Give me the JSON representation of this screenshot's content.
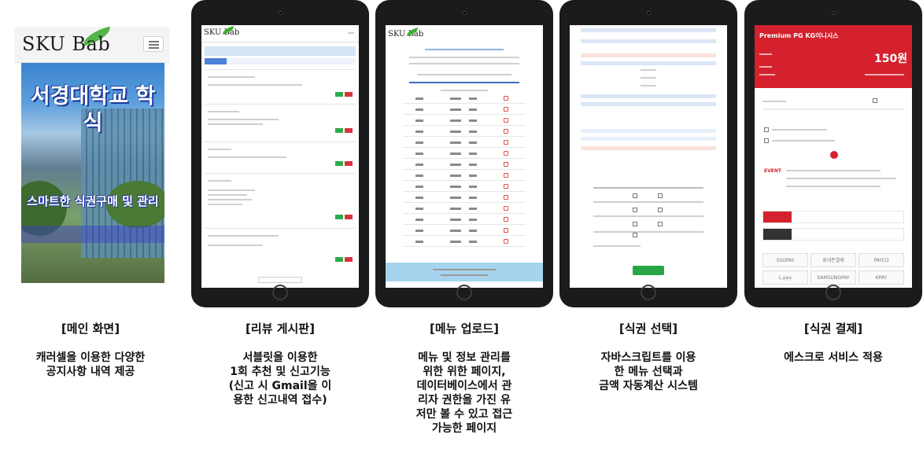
{
  "main_screen": {
    "logo": "SKU Bab",
    "hero_title": "서경대학교 학식",
    "hero_subtitle": "스마트한 식권구매 및 관리"
  },
  "panels": [
    {
      "title": "[메인 화면]",
      "description": "캐러셀을 이용한 다양한\n공지사항 내역 제공"
    },
    {
      "title": "[리뷰 게시판]",
      "description": "서블릿을 이용한\n1회 추천 및 신고기능\n(신고 시 Gmail을 이\n용한 신고내역 접수)"
    },
    {
      "title": "[메뉴 업로드]",
      "description": "메뉴 및 정보 관리를\n위한  위한 페이지,\n데이터베이스에서 관\n리자 권한을 가진 유\n저만 볼 수 있고 접근\n가능한 페이지"
    },
    {
      "title": "[식권 선택]",
      "description": "자바스크립트를 이용\n한 메뉴 선택과\n금액 자동계산 시스템"
    },
    {
      "title": "[식권 결제]",
      "description": "에스크로 서비스 적용"
    }
  ],
  "payment_screen": {
    "header_name": "Premium PG KG이니시스",
    "amount": "150원",
    "event_label": "EVENT",
    "methods": [
      "SSGPAY",
      "휴대폰결제",
      "PAYCO",
      "L.pay",
      "SAMSUNGPAY",
      "KPAY"
    ]
  },
  "colors": {
    "payment_red": "#d4212d",
    "confirm_green": "#29a646",
    "accent_blue": "#4c82d8"
  }
}
